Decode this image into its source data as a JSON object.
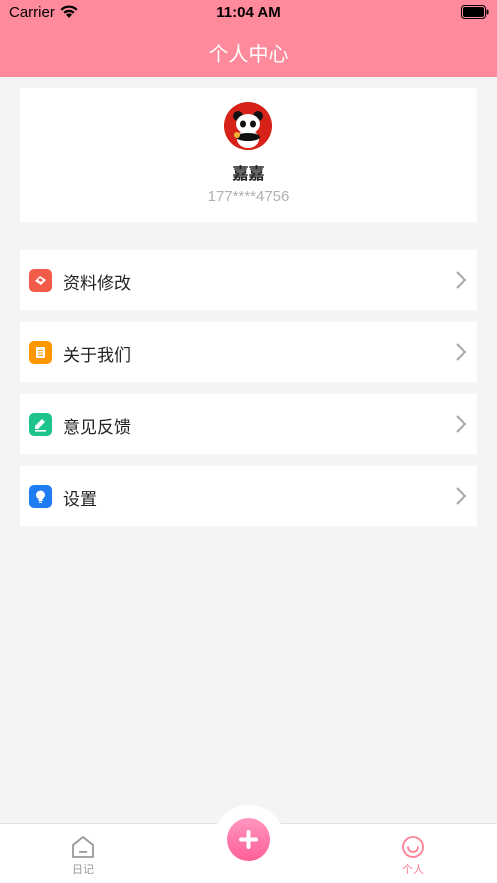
{
  "status_bar": {
    "carrier": "Carrier",
    "time": "11:04 AM"
  },
  "header": {
    "title": "个人中心"
  },
  "profile": {
    "name": "嘉嘉",
    "phone": "177****4756"
  },
  "menu": [
    {
      "label": "资料修改",
      "icon": "profile-edit-icon",
      "color": "#f25a4a"
    },
    {
      "label": "关于我们",
      "icon": "document-icon",
      "color": "#ff9800"
    },
    {
      "label": "意见反馈",
      "icon": "feedback-icon",
      "color": "#1ec48a"
    },
    {
      "label": "设置",
      "icon": "settings-bulb-icon",
      "color": "#1e7df2"
    }
  ],
  "tabbar": {
    "diary_label": "日记",
    "me_label": "个人"
  },
  "colors": {
    "header": "#ff8a9b",
    "accent": "#ff7f95"
  }
}
